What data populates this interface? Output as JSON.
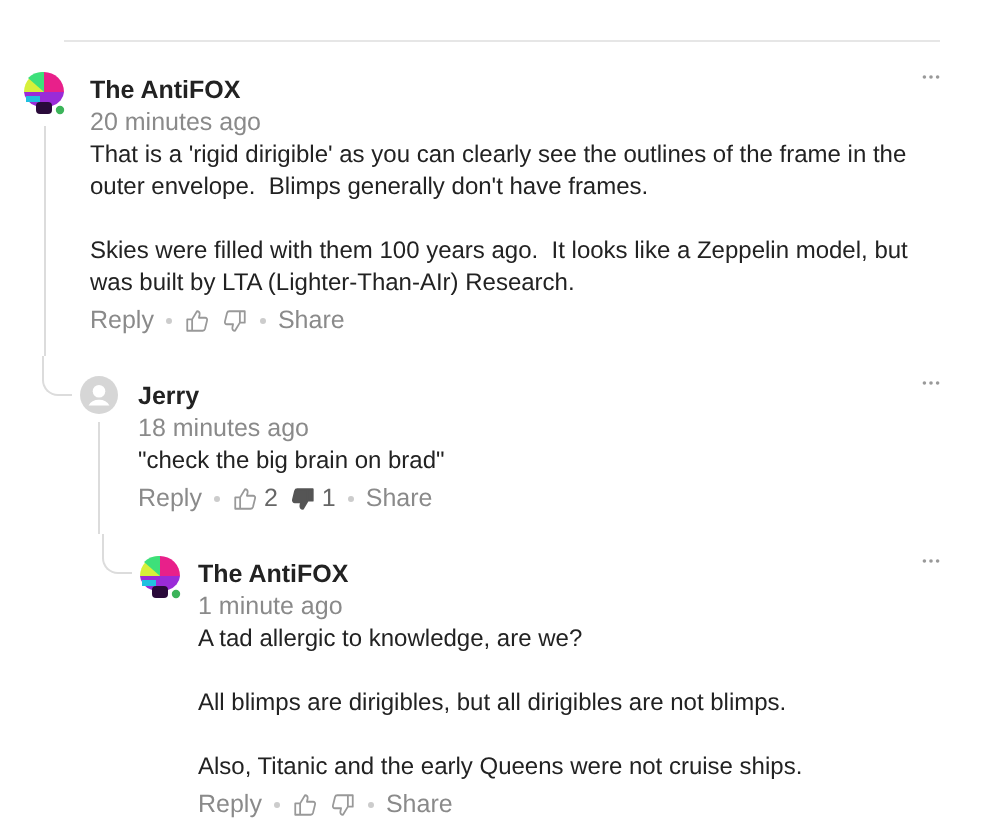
{
  "comments": [
    {
      "author": "The AntiFOX",
      "avatar": {
        "kind": "colorful"
      },
      "time": "20 minutes ago",
      "paragraphs": [
        "That is a 'rigid dirigible' as you can clearly see the outlines of the frame in the outer envelope.  Blimps generally don't have frames.",
        "Skies were filled with them 100 years ago.  It looks like a Zeppelin model, but was built by LTA (Lighter-Than-AIr) Research."
      ],
      "reply_label": "Reply",
      "share_label": "Share",
      "liked": false,
      "disliked": false,
      "replies": [
        {
          "author": "Jerry",
          "avatar": {
            "kind": "placeholder"
          },
          "time": "18 minutes ago",
          "paragraphs": [
            "\"check the big brain on brad\""
          ],
          "reply_label": "Reply",
          "share_label": "Share",
          "like_count": "2",
          "dislike_count": "1",
          "liked": false,
          "disliked": true,
          "replies": [
            {
              "author": "The AntiFOX",
              "avatar": {
                "kind": "colorful"
              },
              "time": "1 minute ago",
              "paragraphs": [
                "A tad allergic to knowledge, are we?",
                "All blimps are dirigibles, but all dirigibles are not blimps.",
                "Also, Titanic and the early Queens were not cruise ships."
              ],
              "reply_label": "Reply",
              "share_label": "Share",
              "liked": false,
              "disliked": false
            }
          ]
        }
      ]
    }
  ]
}
